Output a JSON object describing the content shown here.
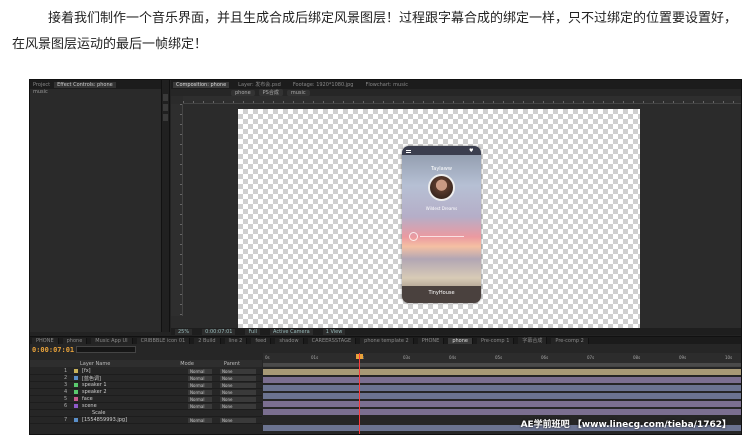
{
  "article": {
    "text": "接着我们制作一个音乐界面，并且生成合成后绑定风景图层！过程跟字幕合成的绑定一样，只不过绑定的位置要设置好，在风景图层运动的最后一帧绑定！"
  },
  "ae": {
    "project_tabs": [
      "Project",
      "Effect Controls: phone"
    ],
    "project_sub": "music",
    "comp_tabs": [
      "Composition: phone",
      "Layer: 发布会.psd",
      "Footage: 1920*1080.jpg",
      "Flowchart: music"
    ],
    "breadcrumbs": [
      "phone",
      "PS合成",
      "music"
    ],
    "phone": {
      "artist": "Taylaww",
      "song": "Wildest Dreams",
      "bottom_label": "TinyHouse"
    },
    "viewer_bar": [
      "25%",
      "0:00:07:01",
      "Full",
      "Active Camera",
      "1 View"
    ],
    "timeline_tabs": [
      "PHONE",
      "phone",
      "Music App UI",
      "CRIBBBLE icon 01",
      "2 Build",
      "line 2",
      "feed",
      "shadow",
      "CAREERSSTAGE",
      "phone template 2",
      "PHONE",
      "phone",
      "Pre-comp 1",
      "字幕合成",
      "Pre-comp 2"
    ],
    "timecode": "0:00:07:01",
    "header": {
      "name": "Layer Name",
      "mode": "Mode",
      "parent": "Parent"
    },
    "layers": [
      {
        "num": "1",
        "name": "[fx]",
        "mode": "Normal",
        "parent": "None",
        "color": "#c9b35a"
      },
      {
        "num": "2",
        "name": "[蓝色调]",
        "mode": "Normal",
        "parent": "None",
        "color": "#5a8fc9"
      },
      {
        "num": "3",
        "name": "speaker 1",
        "mode": "Normal",
        "parent": "None",
        "color": "#5ac96e"
      },
      {
        "num": "4",
        "name": "speaker 2",
        "mode": "Normal",
        "parent": "None",
        "color": "#5ac96e"
      },
      {
        "num": "5",
        "name": "face",
        "mode": "Normal",
        "parent": "None",
        "color": "#c95a8f"
      },
      {
        "num": "6",
        "name": "scene",
        "mode": "Normal",
        "parent": "None",
        "color": "#8f5ac9"
      },
      {
        "num": "",
        "name": "Scale",
        "mode": "",
        "parent": "",
        "color": "#262626"
      },
      {
        "num": "7",
        "name": "[1554859993.jpg]",
        "mode": "Normal",
        "parent": "None",
        "color": "#5a8fc9"
      }
    ],
    "ruler_ticks": [
      "0s",
      "01s",
      "02s",
      "03s",
      "04s",
      "05s",
      "06s",
      "07s",
      "08s",
      "09s",
      "10s"
    ],
    "watermark": "AE学前班吧 【www.linecg.com/tieba/1762】"
  }
}
